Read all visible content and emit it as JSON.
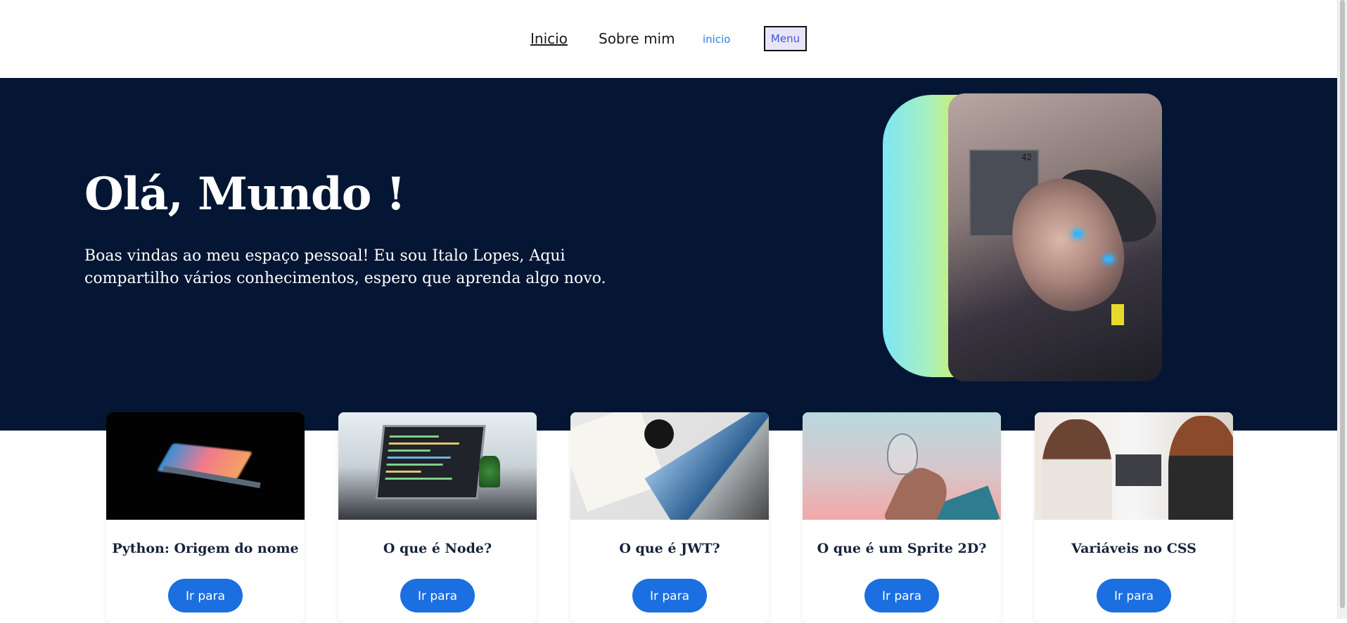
{
  "nav": {
    "items": [
      {
        "label": "Inicio"
      },
      {
        "label": "Sobre mim"
      },
      {
        "label": "inicio"
      }
    ],
    "menu_label": "Menu"
  },
  "hero": {
    "title": "Olá, Mundo !",
    "text": "Boas vindas ao meu espaço pessoal! Eu sou Italo Lopes, Aqui compartilho vários conhecimentos, espero que aprenda algo novo.",
    "photo_number": "42",
    "colors": {
      "background": "#041633",
      "gradient_start": "#7fe6f5",
      "gradient_end": "#fff200"
    }
  },
  "cards": [
    {
      "title": "Python: Origem do nome",
      "button_label": "Ir para"
    },
    {
      "title": "O que é Node?",
      "button_label": "Ir para"
    },
    {
      "title": "O que é JWT?",
      "button_label": "Ir para"
    },
    {
      "title": "O que é um Sprite 2D?",
      "button_label": "Ir para"
    },
    {
      "title": "Variáveis no CSS",
      "button_label": "Ir para"
    }
  ],
  "colors": {
    "accent": "#1b6fe0",
    "link": "#2c7be5"
  }
}
